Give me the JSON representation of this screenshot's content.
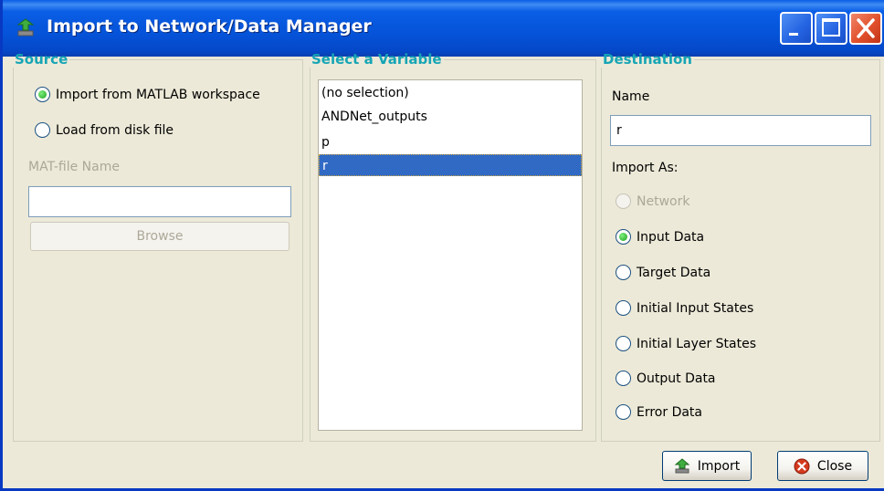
{
  "window": {
    "title": "Import to Network/Data Manager"
  },
  "source": {
    "legend": "Source",
    "options": [
      {
        "label": "Import from MATLAB workspace",
        "selected": true
      },
      {
        "label": "Load from disk file",
        "selected": false
      }
    ],
    "matfile_label": "MAT-file Name",
    "matfile_value": "",
    "browse_label": "Browse"
  },
  "variable": {
    "legend": "Select a Variable",
    "items": [
      "(no selection)",
      "ANDNet_outputs",
      "p",
      "r"
    ],
    "selected": "r"
  },
  "destination": {
    "legend": "Destination",
    "name_label": "Name",
    "name_value": "r",
    "import_as_label": "Import As:",
    "options": [
      {
        "label": "Network",
        "enabled": false,
        "selected": false
      },
      {
        "label": "Input Data",
        "enabled": true,
        "selected": true
      },
      {
        "label": "Target Data",
        "enabled": true,
        "selected": false
      },
      {
        "label": "Initial Input States",
        "enabled": true,
        "selected": false
      },
      {
        "label": "Initial Layer States",
        "enabled": true,
        "selected": false
      },
      {
        "label": "Output Data",
        "enabled": true,
        "selected": false
      },
      {
        "label": "Error Data",
        "enabled": true,
        "selected": false
      }
    ]
  },
  "buttons": {
    "import_label": "Import",
    "close_label": "Close"
  },
  "colors": {
    "titlebar": "#0553d8",
    "legend": "#16a5b5",
    "selection": "#316ac5",
    "radio_on": "#1ea01e"
  }
}
